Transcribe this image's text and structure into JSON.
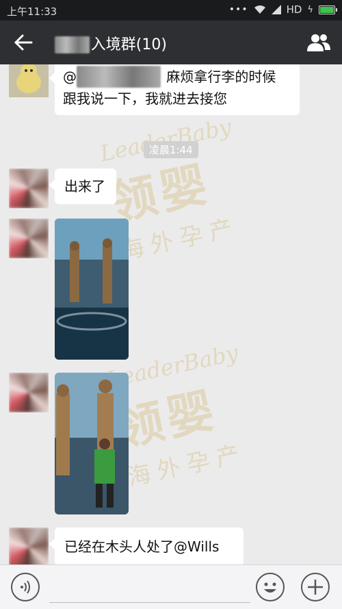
{
  "status_bar": {
    "time": "上午11:33",
    "network": "HD"
  },
  "nav": {
    "title_suffix": "入境群(10)"
  },
  "watermark": {
    "brand": "LeaderBaby",
    "cn": "领婴",
    "slogan": "海外孕产"
  },
  "chat": {
    "messages": [
      {
        "type": "text",
        "text_line1": "@",
        "text_line1_rest": "麻烦拿行李的时候",
        "text_line2": "跟我说一下，我就进去接您"
      },
      {
        "type": "time",
        "text": "凌晨1:44"
      },
      {
        "type": "text",
        "text": "出来了"
      },
      {
        "type": "image"
      },
      {
        "type": "image"
      },
      {
        "type": "text",
        "text": "已经在木头人处了@Wills"
      }
    ]
  },
  "colors": {
    "nav": "#2d2f33",
    "status": "#1a1b1d",
    "bg": "#ebebeb",
    "battery": "#41c14d"
  },
  "battery_level": 0.9
}
